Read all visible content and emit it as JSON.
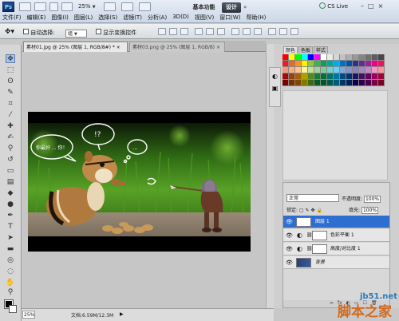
{
  "app": {
    "logo": "Ps",
    "zoom_display": "25%"
  },
  "menu": {
    "items": [
      "文件(F)",
      "编辑(E)",
      "图像(I)",
      "图层(L)",
      "选择(S)",
      "滤镜(T)",
      "分析(A)",
      "3D(D)",
      "视图(V)",
      "窗口(W)",
      "帮助(H)"
    ],
    "workspace": "基本功能",
    "design": "设计",
    "more": "»",
    "cslive": "CS Live",
    "window_controls": [
      "–",
      "□",
      "×"
    ]
  },
  "options": {
    "auto_select_label": "自动选择:",
    "auto_select_value": "组",
    "show_transform_label": "显示变换控件"
  },
  "documents": {
    "active_tab": "素材01.jpg @ 25% (图层 1, RGB/8#) *",
    "inactive_tab": "素材03.png @ 25% (图层 1, RGB/8)",
    "close_glyph": "×"
  },
  "photo": {
    "bubble_left": "你最好 ... 你！",
    "bubble_mid": "!?",
    "bubble_right": "..."
  },
  "status": {
    "zoom": "25%",
    "doc_info": "文档:6.59M/12.3M"
  },
  "panels": {
    "swatch_tabs": [
      "颜色",
      "色板",
      "样式"
    ],
    "swatch_colors": [
      "#ff0000",
      "#ffff00",
      "#00ff00",
      "#00ffff",
      "#0000ff",
      "#ff00ff",
      "#ffffff",
      "#ebebeb",
      "#d6d6d6",
      "#c2c2c2",
      "#adadad",
      "#999999",
      "#858585",
      "#707070",
      "#5c5c5c",
      "#474747",
      "#ed1c24",
      "#f26522",
      "#f7941d",
      "#fff200",
      "#8dc63f",
      "#39b54a",
      "#00a651",
      "#00a99d",
      "#00aeef",
      "#0072bc",
      "#0054a6",
      "#2e3192",
      "#662d91",
      "#92278f",
      "#ec008c",
      "#ed145b",
      "#f7977a",
      "#f9ad81",
      "#fdc68a",
      "#fff79a",
      "#c4df9b",
      "#a3d39c",
      "#82ca9d",
      "#7bcdc8",
      "#6ecff6",
      "#7ea7d8",
      "#8493ca",
      "#8882be",
      "#a187be",
      "#bc8dbf",
      "#f49ac2",
      "#f6989d",
      "#9e0b0f",
      "#a0410d",
      "#a3620a",
      "#aba000",
      "#598527",
      "#1a7b30",
      "#007236",
      "#00746b",
      "#0076a3",
      "#004b80",
      "#003471",
      "#1b1464",
      "#440e62",
      "#630460",
      "#9e005d",
      "#9e0039",
      "#790000",
      "#7b2e00",
      "#7d4900",
      "#827b00",
      "#406618",
      "#005e20",
      "#005826",
      "#005952",
      "#005b7f",
      "#003663",
      "#002157",
      "#0d004c",
      "#32004b",
      "#4b0049",
      "#7b0046",
      "#7a0026"
    ],
    "layers_tabs": [
      "图层",
      "通道",
      "路径"
    ],
    "blend_mode": "正常",
    "opacity_label": "不透明度:",
    "opacity_value": "100%",
    "lock_label": "锁定:",
    "fill_label": "填充:",
    "fill_value": "100%",
    "layers": [
      {
        "name": "图层 1",
        "selected": true
      },
      {
        "name": "色彩平衡 1",
        "selected": false
      },
      {
        "name": "高度/对比度 1",
        "selected": false
      },
      {
        "name": "背景",
        "selected": false
      }
    ],
    "bottom_icons": [
      "∞",
      "fx",
      "◐",
      "▭",
      "☐",
      "🗑"
    ]
  },
  "watermark": {
    "site": "jb51.net",
    "name": "脚本之家"
  }
}
